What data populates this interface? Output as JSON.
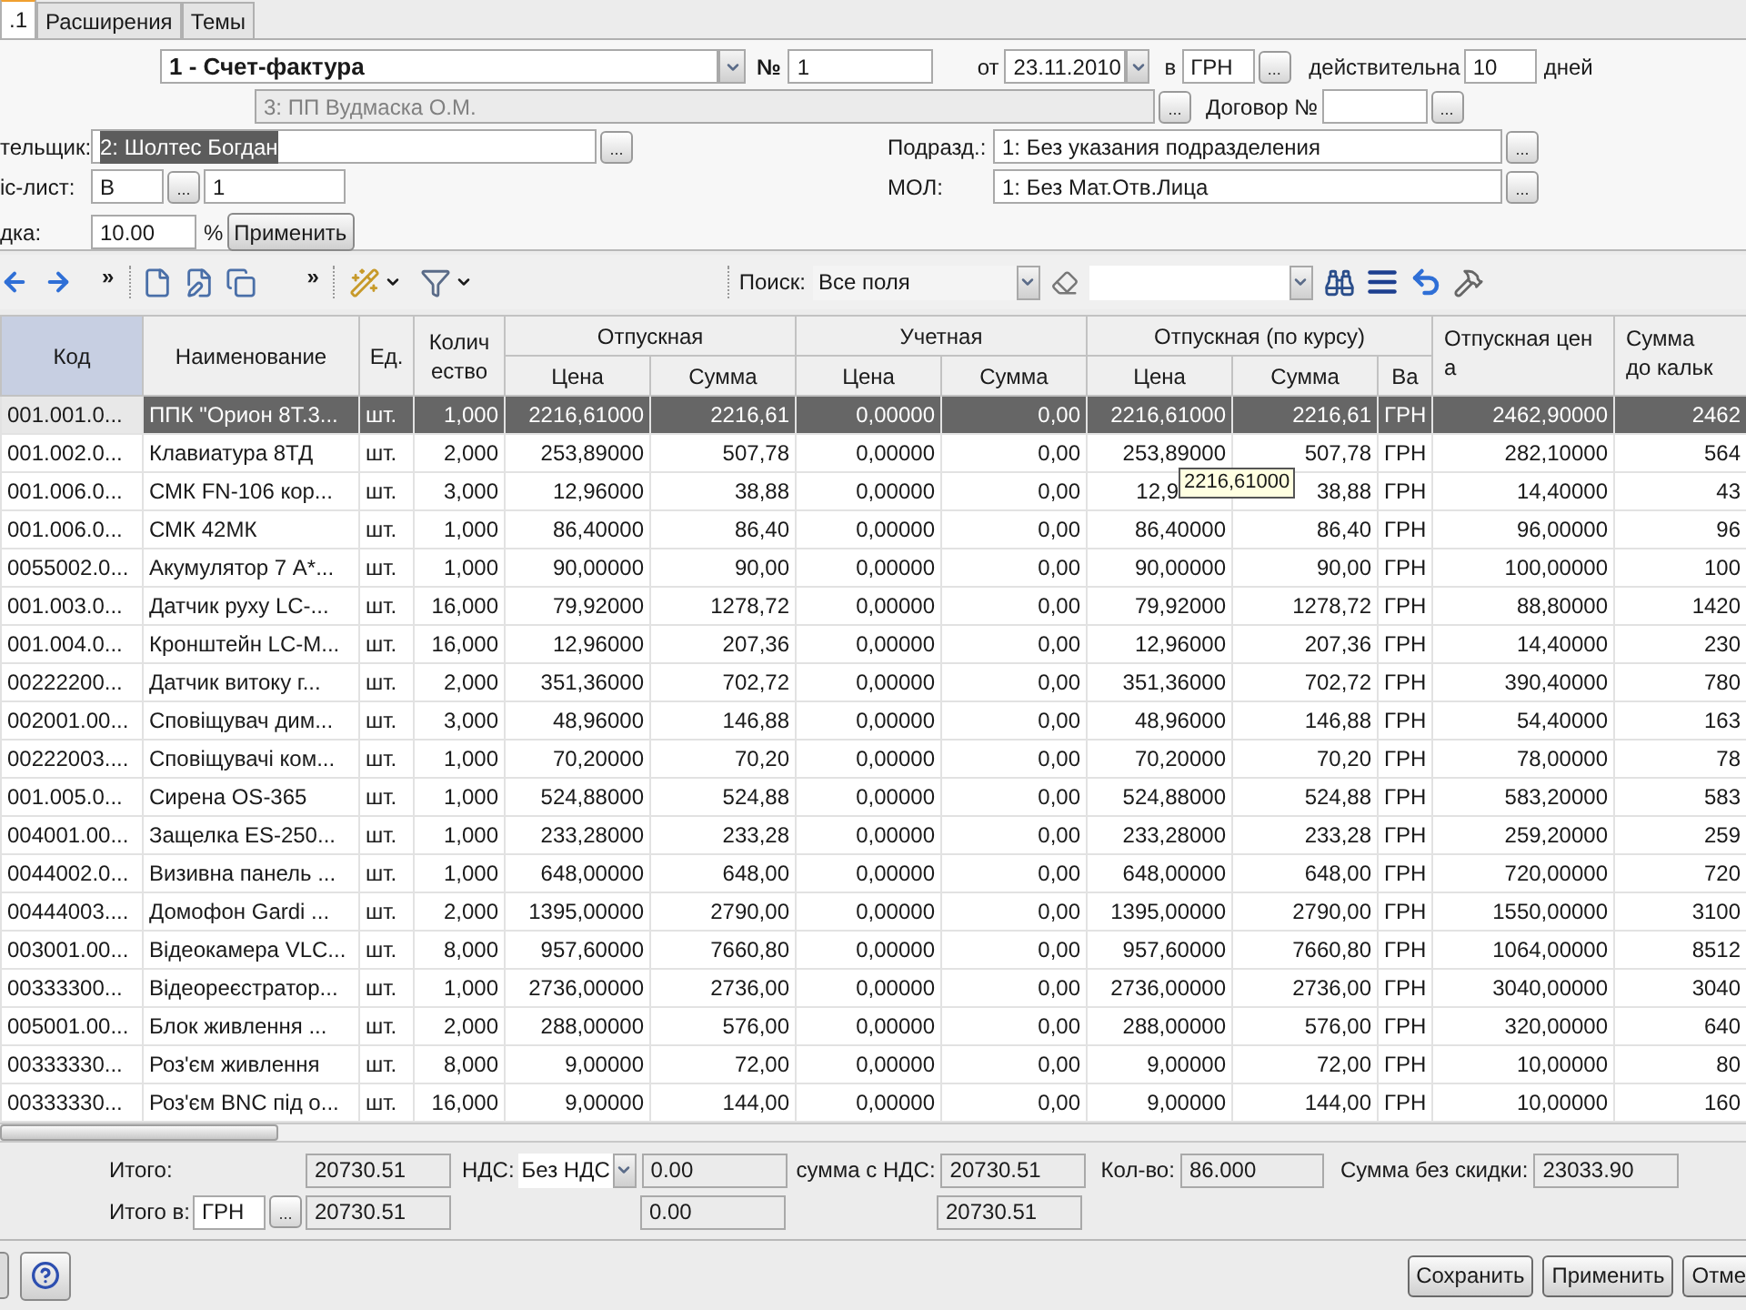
{
  "tabs": [
    {
      "label": ".1",
      "selected": true
    },
    {
      "label": "Расширения",
      "selected": false
    },
    {
      "label": "Темы",
      "selected": false
    }
  ],
  "form": {
    "doc_type": "1 - Счет-фактура",
    "number_label": "№",
    "number": "1",
    "date_label": "от",
    "date": "23.11.2010",
    "currency_label": "в",
    "currency": {
      "value": "ГРН",
      "browse": "..."
    },
    "valid_label": "действительна",
    "valid_days": "10",
    "days_label": "дней",
    "supplier": {
      "value": "3: ПП Вудмаска О.М.",
      "disabled": true,
      "browse": "..."
    },
    "contract_label": "Договор №",
    "contract": {
      "browse": "..."
    },
    "buyer_label": "тельщик:",
    "buyer": {
      "value": "2: Шолтес Богдан",
      "text_selected": true,
      "browse": "..."
    },
    "price_list_label": "іс-лист:",
    "price_list_code": {
      "value": "В",
      "browse": "..."
    },
    "price_list_number": "1",
    "discount_label": "дка:",
    "discount": "10.00",
    "percent": "%",
    "apply": "Применить",
    "division_label": "Подразд.:",
    "division": {
      "value": "1: Без указания подразделения",
      "browse": "..."
    },
    "mol_label": "МОЛ:",
    "mol": {
      "value": "1: Без Мат.Отв.Лица",
      "browse": "..."
    }
  },
  "toolbar": {
    "overflow_marks": [
      "»",
      "»"
    ],
    "search_label": "Поиск:",
    "search_scope": "Все поля"
  },
  "table": {
    "column_groups": [
      {
        "label": "Отпускная"
      },
      {
        "label": "Учетная"
      },
      {
        "label": "Отпускная (по курсу)"
      }
    ],
    "columns": [
      {
        "kind": "single",
        "label": "Код",
        "selected": true
      },
      {
        "kind": "single",
        "label": "Наименование",
        "selected": false
      },
      {
        "kind": "single",
        "label": "Ед.",
        "selected": false
      },
      {
        "kind": "single",
        "label": "Колич\nество",
        "selected": false
      },
      {
        "kind": "group_first",
        "label": "Цена",
        "selected": false
      },
      {
        "kind": "group_next",
        "label": "Сумма",
        "selected": false
      },
      {
        "kind": "group_first",
        "label": "Цена",
        "selected": false
      },
      {
        "kind": "group_next",
        "label": "Сумма",
        "selected": false
      },
      {
        "kind": "group_first",
        "label": "Цена",
        "selected": false
      },
      {
        "kind": "group_next",
        "label": "Сумма",
        "selected": false
      },
      {
        "kind": "group_next",
        "label": "Ва",
        "selected": false
      },
      {
        "kind": "single",
        "label": "Отпускная цен\nа",
        "selected": false
      },
      {
        "kind": "single",
        "label": "Сумма\nдо кальк",
        "selected": false
      }
    ],
    "rows": [
      {
        "selected": true,
        "cells": [
          "001.001.0...",
          "ППК \"Орион 8Т.3...",
          "шт.",
          "1,000",
          "2216,61000",
          "2216,61",
          "0,00000",
          "0,00",
          "2216,61000",
          "2216,61",
          "ГРН",
          "2462,90000",
          "2462"
        ]
      },
      {
        "selected": false,
        "cells": [
          "001.002.0...",
          "Клавиатура 8ТД",
          "шт.",
          "2,000",
          "253,89000",
          "507,78",
          "0,00000",
          "0,00",
          "253,89000",
          "507,78",
          "ГРН",
          "282,10000",
          "564"
        ]
      },
      {
        "selected": false,
        "cells": [
          "001.006.0...",
          "СМК FN-106 кор...",
          "шт.",
          "3,000",
          "12,96000",
          "38,88",
          "0,00000",
          "0,00",
          "12,9",
          "38,88",
          "ГРН",
          "14,40000",
          "43"
        ],
        "tooltip": "2216,61000"
      },
      {
        "selected": false,
        "cells": [
          "001.006.0...",
          "СМК 42МК",
          "шт.",
          "1,000",
          "86,40000",
          "86,40",
          "0,00000",
          "0,00",
          "86,40000",
          "86,40",
          "ГРН",
          "96,00000",
          "96"
        ]
      },
      {
        "selected": false,
        "cells": [
          "0055002.0...",
          "Акумулятор 7 А*...",
          "шт.",
          "1,000",
          "90,00000",
          "90,00",
          "0,00000",
          "0,00",
          "90,00000",
          "90,00",
          "ГРН",
          "100,00000",
          "100"
        ]
      },
      {
        "selected": false,
        "cells": [
          "001.003.0...",
          "Датчик руху LC-...",
          "шт.",
          "16,000",
          "79,92000",
          "1278,72",
          "0,00000",
          "0,00",
          "79,92000",
          "1278,72",
          "ГРН",
          "88,80000",
          "1420"
        ]
      },
      {
        "selected": false,
        "cells": [
          "001.004.0...",
          "Кронштейн LC-M...",
          "шт.",
          "16,000",
          "12,96000",
          "207,36",
          "0,00000",
          "0,00",
          "12,96000",
          "207,36",
          "ГРН",
          "14,40000",
          "230"
        ]
      },
      {
        "selected": false,
        "cells": [
          "00222200...",
          "Датчик витоку г...",
          "шт.",
          "2,000",
          "351,36000",
          "702,72",
          "0,00000",
          "0,00",
          "351,36000",
          "702,72",
          "ГРН",
          "390,40000",
          "780"
        ]
      },
      {
        "selected": false,
        "cells": [
          "002001.00...",
          "Сповіщувач дим...",
          "шт.",
          "3,000",
          "48,96000",
          "146,88",
          "0,00000",
          "0,00",
          "48,96000",
          "146,88",
          "ГРН",
          "54,40000",
          "163"
        ]
      },
      {
        "selected": false,
        "cells": [
          "00222003....",
          "Сповіщувачі ком...",
          "шт.",
          "1,000",
          "70,20000",
          "70,20",
          "0,00000",
          "0,00",
          "70,20000",
          "70,20",
          "ГРН",
          "78,00000",
          "78"
        ]
      },
      {
        "selected": false,
        "cells": [
          "001.005.0...",
          "Сирена OS-365",
          "шт.",
          "1,000",
          "524,88000",
          "524,88",
          "0,00000",
          "0,00",
          "524,88000",
          "524,88",
          "ГРН",
          "583,20000",
          "583"
        ]
      },
      {
        "selected": false,
        "cells": [
          "004001.00...",
          "Защелка ES-250...",
          "шт.",
          "1,000",
          "233,28000",
          "233,28",
          "0,00000",
          "0,00",
          "233,28000",
          "233,28",
          "ГРН",
          "259,20000",
          "259"
        ]
      },
      {
        "selected": false,
        "cells": [
          "0044002.0...",
          "Визивна панель ...",
          "шт.",
          "1,000",
          "648,00000",
          "648,00",
          "0,00000",
          "0,00",
          "648,00000",
          "648,00",
          "ГРН",
          "720,00000",
          "720"
        ]
      },
      {
        "selected": false,
        "cells": [
          "00444003....",
          "Домофон Gardi ...",
          "шт.",
          "2,000",
          "1395,00000",
          "2790,00",
          "0,00000",
          "0,00",
          "1395,00000",
          "2790,00",
          "ГРН",
          "1550,00000",
          "3100"
        ]
      },
      {
        "selected": false,
        "cells": [
          "003001.00...",
          "Відеокамера VLC...",
          "шт.",
          "8,000",
          "957,60000",
          "7660,80",
          "0,00000",
          "0,00",
          "957,60000",
          "7660,80",
          "ГРН",
          "1064,00000",
          "8512"
        ]
      },
      {
        "selected": false,
        "cells": [
          "00333300...",
          "Відеореєстратор...",
          "шт.",
          "1,000",
          "2736,00000",
          "2736,00",
          "0,00000",
          "0,00",
          "2736,00000",
          "2736,00",
          "ГРН",
          "3040,00000",
          "3040"
        ]
      },
      {
        "selected": false,
        "cells": [
          "005001.00...",
          "Блок живлення ...",
          "шт.",
          "2,000",
          "288,00000",
          "576,00",
          "0,00000",
          "0,00",
          "288,00000",
          "576,00",
          "ГРН",
          "320,00000",
          "640"
        ]
      },
      {
        "selected": false,
        "cells": [
          "00333330...",
          "Роз'єм живлення",
          "шт.",
          "8,000",
          "9,00000",
          "72,00",
          "0,00000",
          "0,00",
          "9,00000",
          "72,00",
          "ГРН",
          "10,00000",
          "80"
        ]
      },
      {
        "selected": false,
        "cells": [
          "00333330...",
          "Роз'єм BNC під о...",
          "шт.",
          "16,000",
          "9,00000",
          "144,00",
          "0,00000",
          "0,00",
          "9,00000",
          "144,00",
          "ГРН",
          "10,00000",
          "160"
        ]
      }
    ]
  },
  "totals": {
    "total_label": "Итого:",
    "total": "20730.51",
    "vat_label": "НДС:",
    "vat_type": "Без НДС",
    "vat": "0.00",
    "with_vat_label": "сумма с НДС:",
    "with_vat": "20730.51",
    "qty_label": "Кол-во:",
    "qty": "86.000",
    "no_discount_label": "Сумма без скидки:",
    "no_discount": "23033.90",
    "total_in_label": "Итого в:",
    "total_in_currency": {
      "value": "ГРН",
      "browse": "..."
    },
    "total_in": "20730.51",
    "vat_in": "0.00",
    "with_vat_in": "20730.51"
  },
  "buttons": [
    "Сохранить",
    "Применить",
    "Отме"
  ]
}
